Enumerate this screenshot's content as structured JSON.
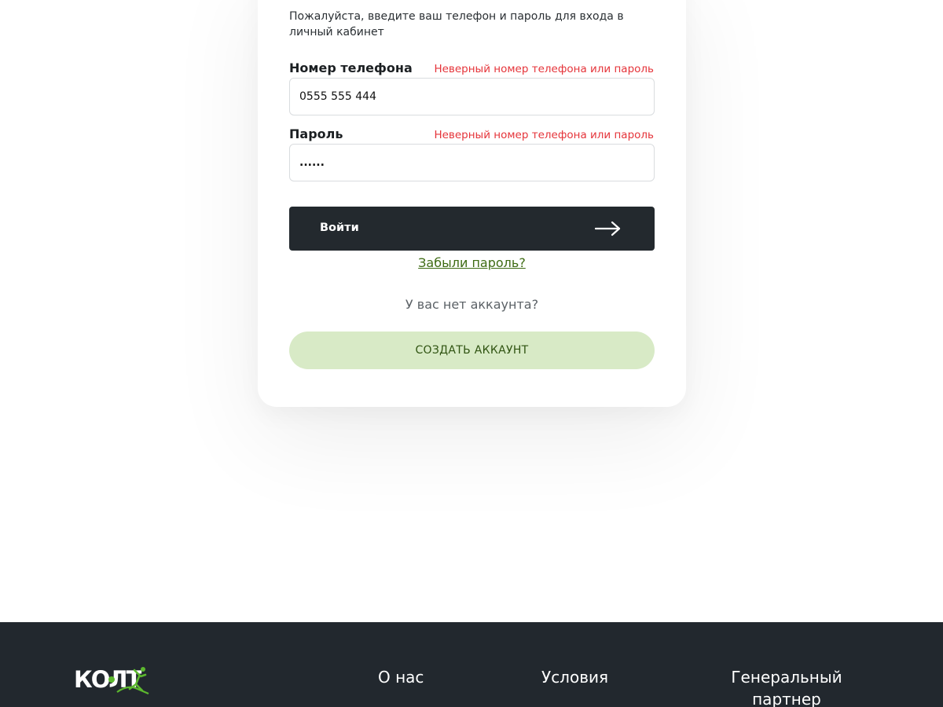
{
  "login": {
    "intro_text": "Пожалуйста, введите ваш телефон и пароль для входа в личный кабинет",
    "phone_label": "Номер телефона",
    "phone_error": "Неверный номер телефона или пароль",
    "phone_value": "0555 555 444",
    "password_label": "Пароль",
    "password_error": "Неверный номер телефона или пароль",
    "password_value": "......",
    "login_button": "Войти",
    "forgot_link": "Забыли пароль?",
    "no_account_text": "У вас нет аккаунта?",
    "create_account_button": "СОЗДАТЬ АККАУНТ"
  },
  "footer": {
    "logo_text": "КОЛТ",
    "links": [
      "О нас",
      "Условия",
      "Генеральный партнер"
    ]
  },
  "colors": {
    "error": "#e5343a",
    "dark": "#23292e",
    "accent_green": "#5cb82e",
    "create_bg": "#d8eac6"
  }
}
